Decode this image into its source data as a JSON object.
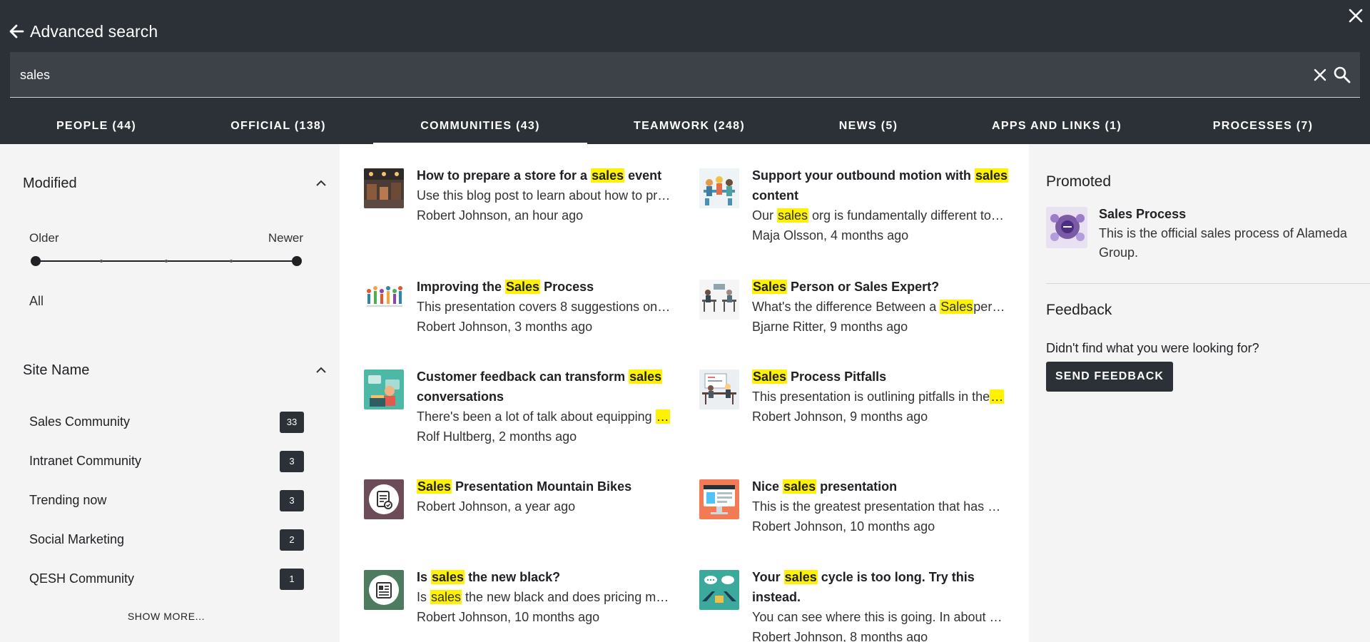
{
  "header": {
    "title": "Advanced search",
    "search_value": "sales",
    "tabs": [
      {
        "label": "PEOPLE (44)"
      },
      {
        "label": "OFFICIAL (138)"
      },
      {
        "label": "COMMUNITIES (43)",
        "active": true
      },
      {
        "label": "TEAMWORK (248)"
      },
      {
        "label": "NEWS (5)"
      },
      {
        "label": "APPS AND LINKS (1)"
      },
      {
        "label": "PROCESSES (7)"
      }
    ]
  },
  "filters": {
    "modified": {
      "title": "Modified",
      "older_label": "Older",
      "newer_label": "Newer",
      "value_label": "All"
    },
    "site_name": {
      "title": "Site Name",
      "items": [
        {
          "label": "Sales Community",
          "count": "33"
        },
        {
          "label": "Intranet Community",
          "count": "3"
        },
        {
          "label": "Trending now",
          "count": "3"
        },
        {
          "label": "Social Marketing",
          "count": "2"
        },
        {
          "label": "QESH Community",
          "count": "1"
        }
      ],
      "show_more": "SHOW MORE..."
    }
  },
  "results": [
    {
      "title_html": "How to prepare a store for a <mark>sales</mark> event",
      "desc_html": "Use this blog post to learn about how to pr…",
      "meta": "Robert Johnson, an hour ago",
      "icon": "store-photo-icon"
    },
    {
      "title_html": "Support your outbound motion with <mark>sales</mark> content",
      "desc_html": "Our <mark>sales</mark> org is fundamentally different to…",
      "meta": "Maja Olsson, 4 months ago",
      "icon": "team-meeting-illustration-icon"
    },
    {
      "title_html": "Improving the <mark>Sales</mark> Process",
      "desc_html": "This presentation covers 8 suggestions on…",
      "meta": "Robert Johnson, 3 months ago",
      "icon": "people-group-illustration-icon"
    },
    {
      "title_html": "<mark>Sales</mark> Person or Sales Expert?",
      "desc_html": "What's the difference Between a <mark>Sales</mark>per…",
      "meta": "Bjarne Ritter, 9 months ago",
      "icon": "office-desks-illustration-icon"
    },
    {
      "title_html": "Customer feedback can transform <mark>sales</mark> conversations",
      "desc_html": "There's been a lot of talk about equipping <mark>…</mark>",
      "meta": "Rolf Hultberg, 2 months ago",
      "icon": "customer-support-illustration-icon"
    },
    {
      "title_html": "<mark>Sales</mark> Process Pitfalls",
      "desc_html": "This presentation is outlining pitfalls in the<mark>…</mark>",
      "meta": "Robert Johnson, 9 months ago",
      "icon": "presentation-illustration-icon"
    },
    {
      "title_html": "<mark>Sales</mark> Presentation Mountain Bikes",
      "desc_html": "",
      "meta": "Robert Johnson, a year ago",
      "icon": "document-badge-icon"
    },
    {
      "title_html": "Nice <mark>sales</mark> presentation",
      "desc_html": "This is the greatest presentation that has …",
      "meta": "Robert Johnson, 10 months ago",
      "icon": "monitor-illustration-icon"
    },
    {
      "title_html": "Is <mark>sales</mark> the new black?",
      "desc_html": "Is <mark>sales</mark> the new black and does pricing m…",
      "meta": "Robert Johnson, 10 months ago",
      "icon": "newspaper-icon"
    },
    {
      "title_html": "Your <mark>sales</mark> cycle is too long. Try this instead.",
      "desc_html": "You can see where this is going. In about …",
      "meta": "Robert Johnson, 8 months ago",
      "icon": "chat-meeting-illustration-icon"
    }
  ],
  "promoted": {
    "title": "Promoted",
    "item_title": "Sales Process",
    "item_desc": "This is the official sales process of Alameda Group."
  },
  "feedback": {
    "title": "Feedback",
    "question": "Didn't find what you were looking for?",
    "button": "SEND FEEDBACK"
  },
  "colors": {
    "header_bg": "#2b3136",
    "highlight": "#fff200"
  }
}
